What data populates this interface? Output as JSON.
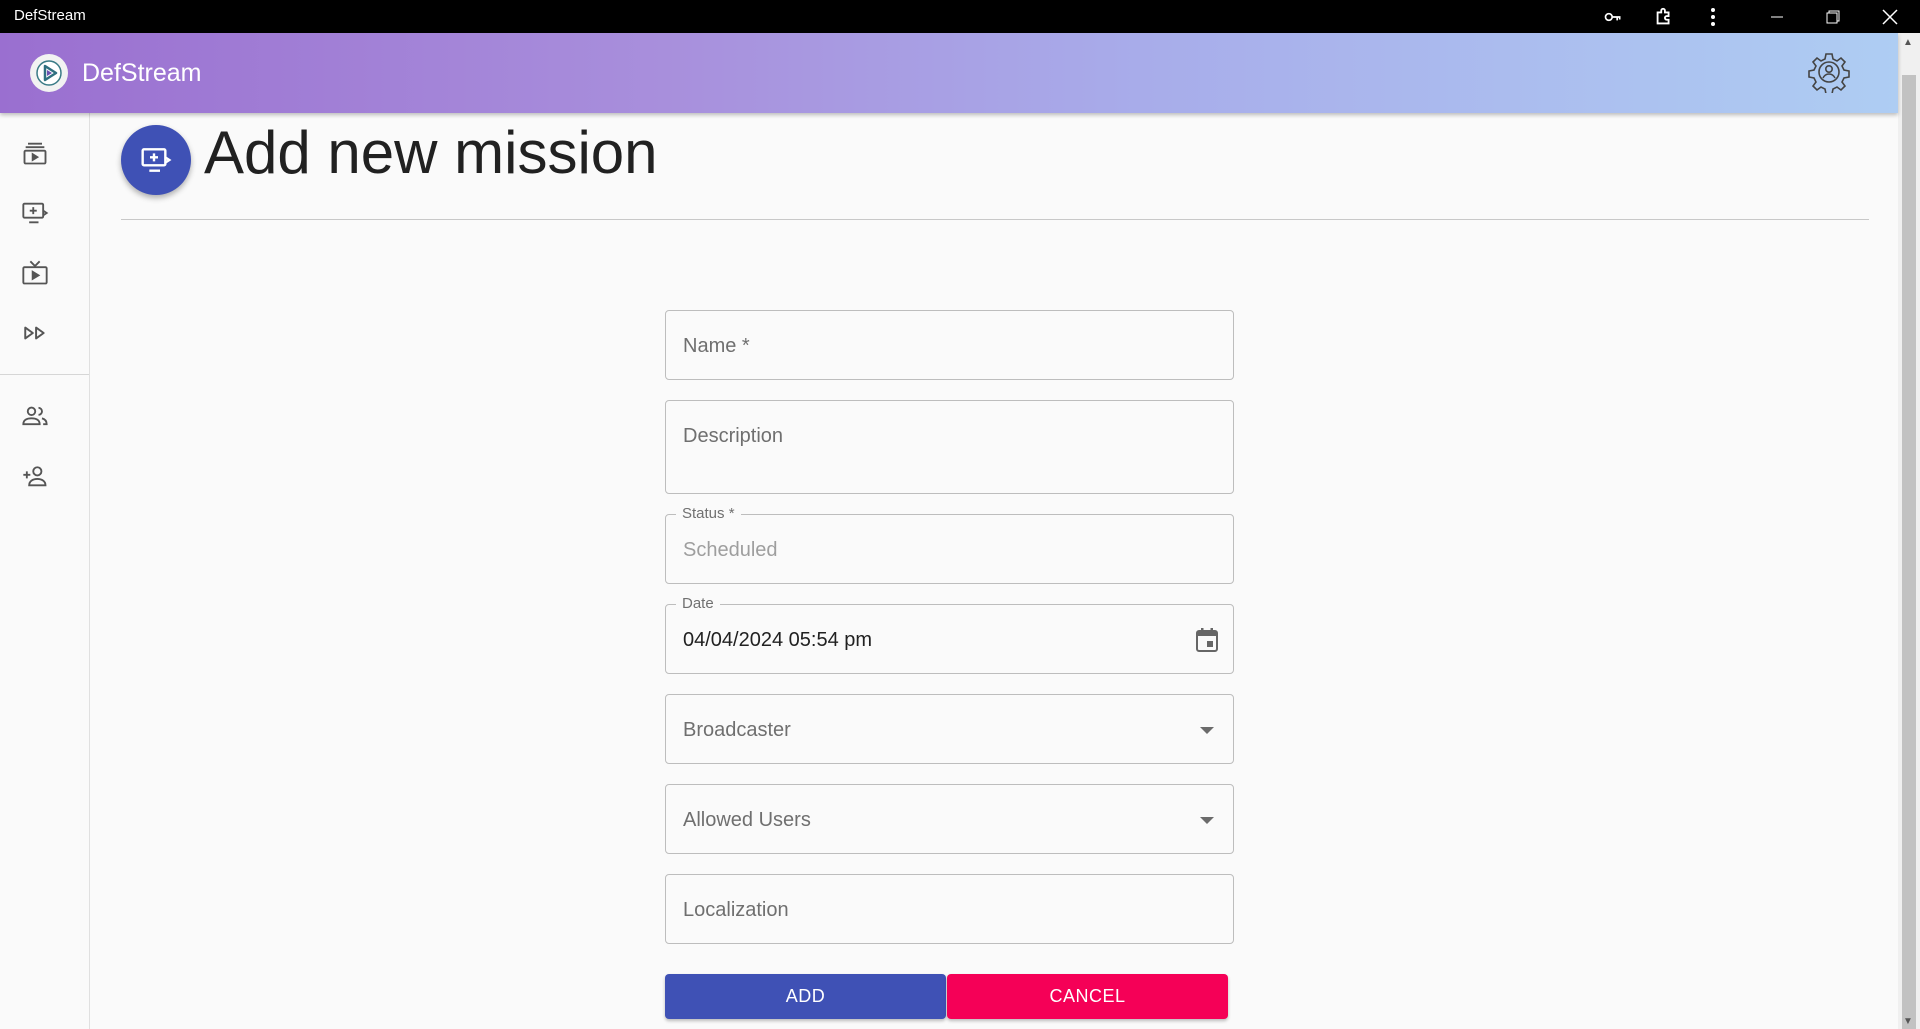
{
  "window": {
    "title": "DefStream"
  },
  "app": {
    "name": "DefStream"
  },
  "page": {
    "title": "Add new mission"
  },
  "form": {
    "name": {
      "placeholder": "Name *"
    },
    "description": {
      "placeholder": "Description"
    },
    "status": {
      "label": "Status *",
      "value": "Scheduled"
    },
    "date": {
      "label": "Date",
      "value": "04/04/2024 05:54 pm"
    },
    "broadcaster": {
      "placeholder": "Broadcaster"
    },
    "allowed_users": {
      "placeholder": "Allowed Users"
    },
    "localization": {
      "placeholder": "Localization"
    }
  },
  "actions": {
    "add_label": "ADD",
    "cancel_label": "CANCEL"
  },
  "colors": {
    "primary": "#3f51b5",
    "accent": "#f50057"
  }
}
